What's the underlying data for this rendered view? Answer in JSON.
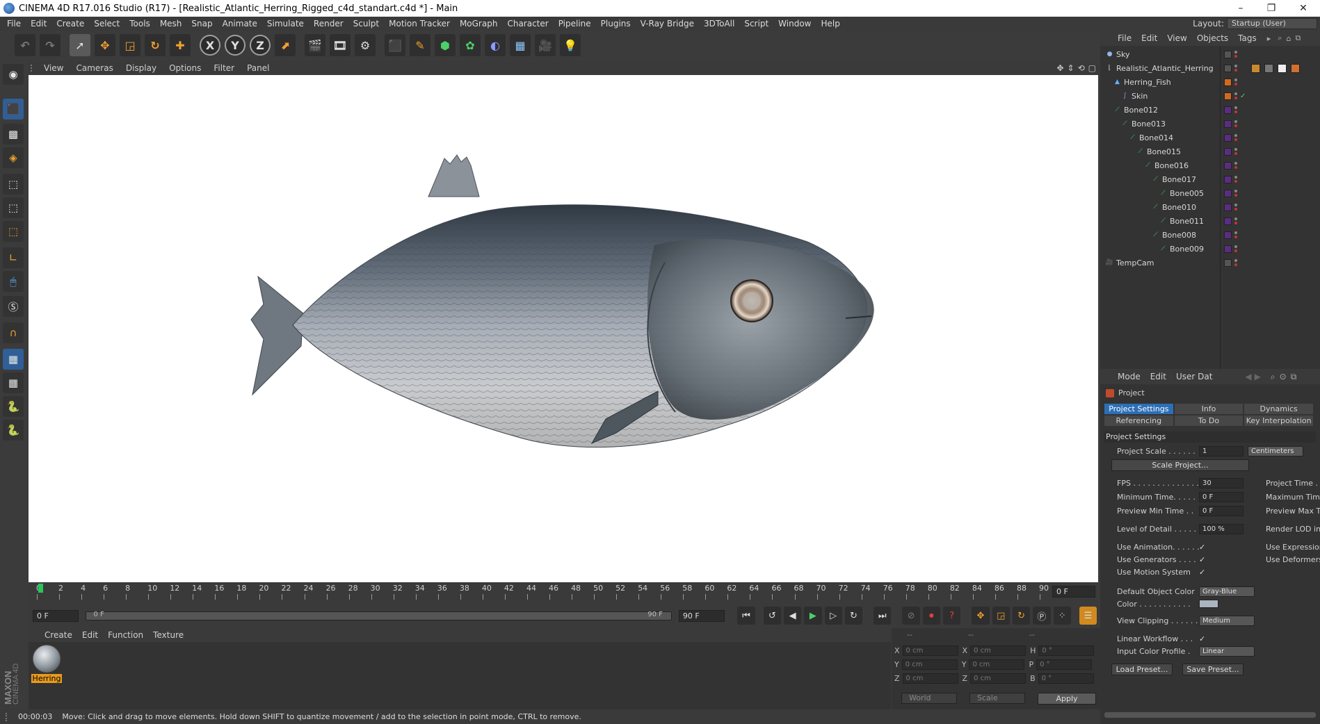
{
  "window": {
    "title": "CINEMA 4D R17.016 Studio (R17) - [Realistic_Atlantic_Herring_Rigged_c4d_standart.c4d *] - Main",
    "controls": [
      "–",
      "❐",
      "✕"
    ]
  },
  "menubar": {
    "items": [
      "File",
      "Edit",
      "Create",
      "Select",
      "Tools",
      "Mesh",
      "Snap",
      "Animate",
      "Simulate",
      "Render",
      "Sculpt",
      "Motion Tracker",
      "MoGraph",
      "Character",
      "Pipeline",
      "Plugins",
      "V-Ray Bridge",
      "3DToAll",
      "Script",
      "Window",
      "Help"
    ],
    "layout_label": "Layout:",
    "layout_value": "Startup (User)"
  },
  "toolbar": {
    "axis_labels": [
      "X",
      "Y",
      "Z"
    ]
  },
  "viewport": {
    "menu": [
      "View",
      "Cameras",
      "Display",
      "Options",
      "Filter",
      "Panel"
    ]
  },
  "timeline": {
    "ticks": [
      "0",
      "2",
      "4",
      "6",
      "8",
      "10",
      "12",
      "14",
      "16",
      "18",
      "20",
      "22",
      "24",
      "26",
      "28",
      "30",
      "32",
      "34",
      "36",
      "38",
      "40",
      "42",
      "44",
      "46",
      "48",
      "50",
      "52",
      "54",
      "56",
      "58",
      "60",
      "62",
      "64",
      "66",
      "68",
      "70",
      "72",
      "74",
      "76",
      "78",
      "80",
      "82",
      "84",
      "86",
      "88",
      "90"
    ],
    "current_frame": "0 F",
    "start_field": "0 F",
    "range_start": "0 F",
    "range_end": "90 F",
    "end_field": "90 F"
  },
  "material_manager": {
    "menu": [
      "Create",
      "Edit",
      "Function",
      "Texture"
    ],
    "material_name": "Herring"
  },
  "coordinates": {
    "header": [
      "--",
      "--",
      "--"
    ],
    "rows": [
      {
        "a": "X",
        "v1": "0 cm",
        "b": "X",
        "v2": "0 cm",
        "c": "H",
        "v3": "0 °"
      },
      {
        "a": "Y",
        "v1": "0 cm",
        "b": "Y",
        "v2": "0 cm",
        "c": "P",
        "v3": "0 °"
      },
      {
        "a": "Z",
        "v1": "0 cm",
        "b": "Z",
        "v2": "0 cm",
        "c": "B",
        "v3": "0 °"
      }
    ],
    "space": "World",
    "mode": "Scale",
    "apply": "Apply"
  },
  "status": {
    "time": "00:00:03",
    "message": "Move: Click and drag to move elements. Hold down SHIFT to quantize movement / add to the selection in point mode, CTRL to remove."
  },
  "object_manager": {
    "menu": [
      "File",
      "Edit",
      "View",
      "Objects",
      "Tags"
    ],
    "objects": [
      {
        "name": "Sky",
        "level": 0,
        "color": "#555555"
      },
      {
        "name": "Realistic_Atlantic_Herring",
        "level": 0,
        "color": "#555555"
      },
      {
        "name": "Herring_Fish",
        "level": 1,
        "color": "#d2691e"
      },
      {
        "name": "Skin",
        "level": 2,
        "color": "#d2691e"
      },
      {
        "name": "Bone012",
        "level": 1,
        "color": "#5a2d82"
      },
      {
        "name": "Bone013",
        "level": 2,
        "color": "#5a2d82"
      },
      {
        "name": "Bone014",
        "level": 3,
        "color": "#5a2d82"
      },
      {
        "name": "Bone015",
        "level": 4,
        "color": "#5a2d82"
      },
      {
        "name": "Bone016",
        "level": 5,
        "color": "#5a2d82"
      },
      {
        "name": "Bone017",
        "level": 6,
        "color": "#5a2d82"
      },
      {
        "name": "Bone005",
        "level": 7,
        "color": "#5a2d82"
      },
      {
        "name": "Bone010",
        "level": 6,
        "color": "#5a2d82"
      },
      {
        "name": "Bone011",
        "level": 7,
        "color": "#5a2d82"
      },
      {
        "name": "Bone008",
        "level": 6,
        "color": "#5a2d82"
      },
      {
        "name": "Bone009",
        "level": 7,
        "color": "#5a2d82"
      },
      {
        "name": "TempCam",
        "level": 0,
        "color": "#555555"
      }
    ]
  },
  "attribute_manager": {
    "menu": [
      "Mode",
      "Edit",
      "User Dat"
    ],
    "object_label": "Project",
    "tabs": [
      "Project Settings",
      "Info",
      "Dynamics",
      "Referencing",
      "To Do",
      "Key Interpolation"
    ],
    "active_tab": "Project Settings",
    "section": "Project Settings",
    "project_scale_label": "Project Scale . . . . . .",
    "project_scale_value": "1",
    "project_scale_unit": "Centimeters",
    "scale_button": "Scale Project...",
    "fps_label": "FPS . . . . . . . . . . . . . .",
    "fps_value": "30",
    "project_time_label": "Project Time . .",
    "min_time_label": "Minimum Time. . . . .",
    "min_time_value": "0 F",
    "max_time_label": "Maximum Time",
    "preview_min_label": "Preview Min Time . .",
    "preview_min_value": "0 F",
    "preview_max_label": "Preview Max Ti",
    "lod_label": "Level of Detail . . . . .",
    "lod_value": "100 %",
    "render_lod_label": "Render LOD in",
    "use_anim_label": "Use Animation. . . . . .",
    "use_expr_label": "Use Expression",
    "use_gen_label": "Use Generators . . . .",
    "use_def_label": "Use Deformers",
    "use_motion_label": "Use Motion System",
    "default_color_label": "Default Object Color",
    "default_color_value": "Gray-Blue",
    "color_label": "Color . . . . . . . . . . .",
    "view_clipping_label": "View Clipping . . . . . .",
    "view_clipping_value": "Medium",
    "linear_workflow_label": "Linear Workflow . . .",
    "input_profile_label": "Input Color Profile .",
    "input_profile_value": "Linear",
    "load_preset": "Load Preset...",
    "save_preset": "Save Preset..."
  },
  "branding": {
    "logo_text": "MAXON CINEMA 4D"
  },
  "colors": {
    "accent_blue": "#2d6fb6",
    "material_label": "#e89a1c",
    "timeline_marker": "#29c45a"
  }
}
